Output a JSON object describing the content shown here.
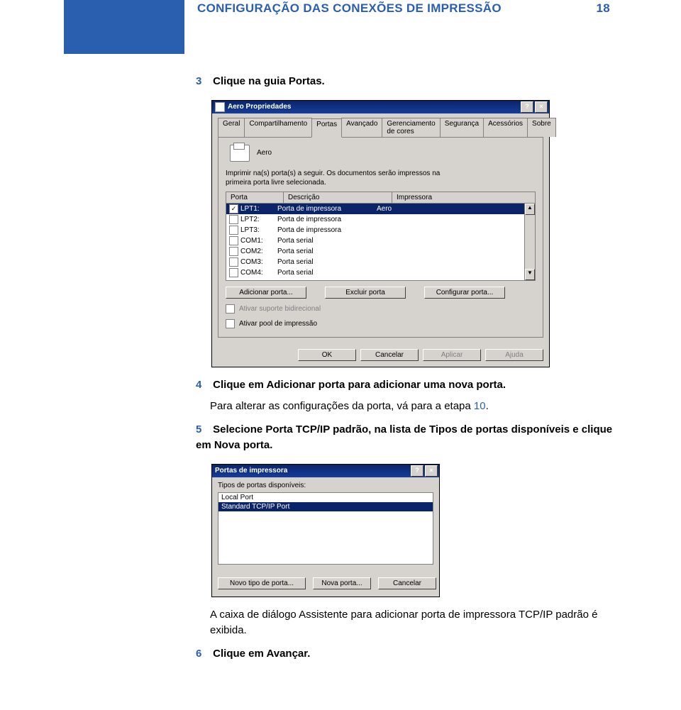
{
  "header": {
    "title": "CONFIGURAÇÃO DAS CONEXÕES DE IMPRESSÃO",
    "page_number": "18"
  },
  "steps": {
    "s3": {
      "num": "3",
      "text": "Clique na guia Portas."
    },
    "s4": {
      "num": "4",
      "text": "Clique em Adicionar porta para adicionar uma nova porta."
    },
    "s4_note_a": "Para alterar as configurações da porta, vá para a etapa ",
    "s4_note_link": "10",
    "s4_note_b": ".",
    "s5": {
      "num": "5",
      "text": "Selecione Porta TCP/IP padrão, na lista de Tipos de portas disponíveis e clique em Nova porta."
    },
    "s5_note": "A caixa de diálogo Assistente para adicionar porta de impressora TCP/IP padrão é exibida.",
    "s6": {
      "num": "6",
      "text": "Clique em Avançar."
    }
  },
  "props_dialog": {
    "title": "Aero Propriedades",
    "tabs": [
      "Geral",
      "Compartilhamento",
      "Portas",
      "Avançado",
      "Gerenciamento de cores",
      "Segurança",
      "Acessórios",
      "Sobre"
    ],
    "active_tab_index": 2,
    "printer_name": "Aero",
    "instruction_l1": "Imprimir na(s) porta(s) a seguir. Os documentos serão impressos na",
    "instruction_l2": "primeira porta livre selecionada.",
    "columns": {
      "port": "Porta",
      "desc": "Descrição",
      "imp": "Impressora"
    },
    "rows": [
      {
        "checked": true,
        "selected": true,
        "port": "LPT1:",
        "desc": "Porta de impressora",
        "imp": "Aero"
      },
      {
        "checked": false,
        "selected": false,
        "port": "LPT2:",
        "desc": "Porta de impressora",
        "imp": ""
      },
      {
        "checked": false,
        "selected": false,
        "port": "LPT3:",
        "desc": "Porta de impressora",
        "imp": ""
      },
      {
        "checked": false,
        "selected": false,
        "port": "COM1:",
        "desc": "Porta serial",
        "imp": ""
      },
      {
        "checked": false,
        "selected": false,
        "port": "COM2:",
        "desc": "Porta serial",
        "imp": ""
      },
      {
        "checked": false,
        "selected": false,
        "port": "COM3:",
        "desc": "Porta serial",
        "imp": ""
      },
      {
        "checked": false,
        "selected": false,
        "port": "COM4:",
        "desc": "Porta serial",
        "imp": ""
      }
    ],
    "buttons": {
      "add": "Adicionar porta...",
      "del": "Excluir porta",
      "conf": "Configurar porta..."
    },
    "options": {
      "bidi": "Ativar suporte bidirecional",
      "pool": "Ativar pool de impressão"
    },
    "footer": {
      "ok": "OK",
      "cancel": "Cancelar",
      "apply": "Aplicar",
      "help": "Ajuda"
    }
  },
  "ports_dialog": {
    "title": "Portas de impressora",
    "label": "Tipos de portas disponíveis:",
    "items": [
      {
        "text": "Local Port",
        "selected": false
      },
      {
        "text": "Standard TCP/IP Port",
        "selected": true
      }
    ],
    "buttons": {
      "new_type": "Novo tipo de porta...",
      "new_port": "Nova porta...",
      "cancel": "Cancelar"
    }
  }
}
